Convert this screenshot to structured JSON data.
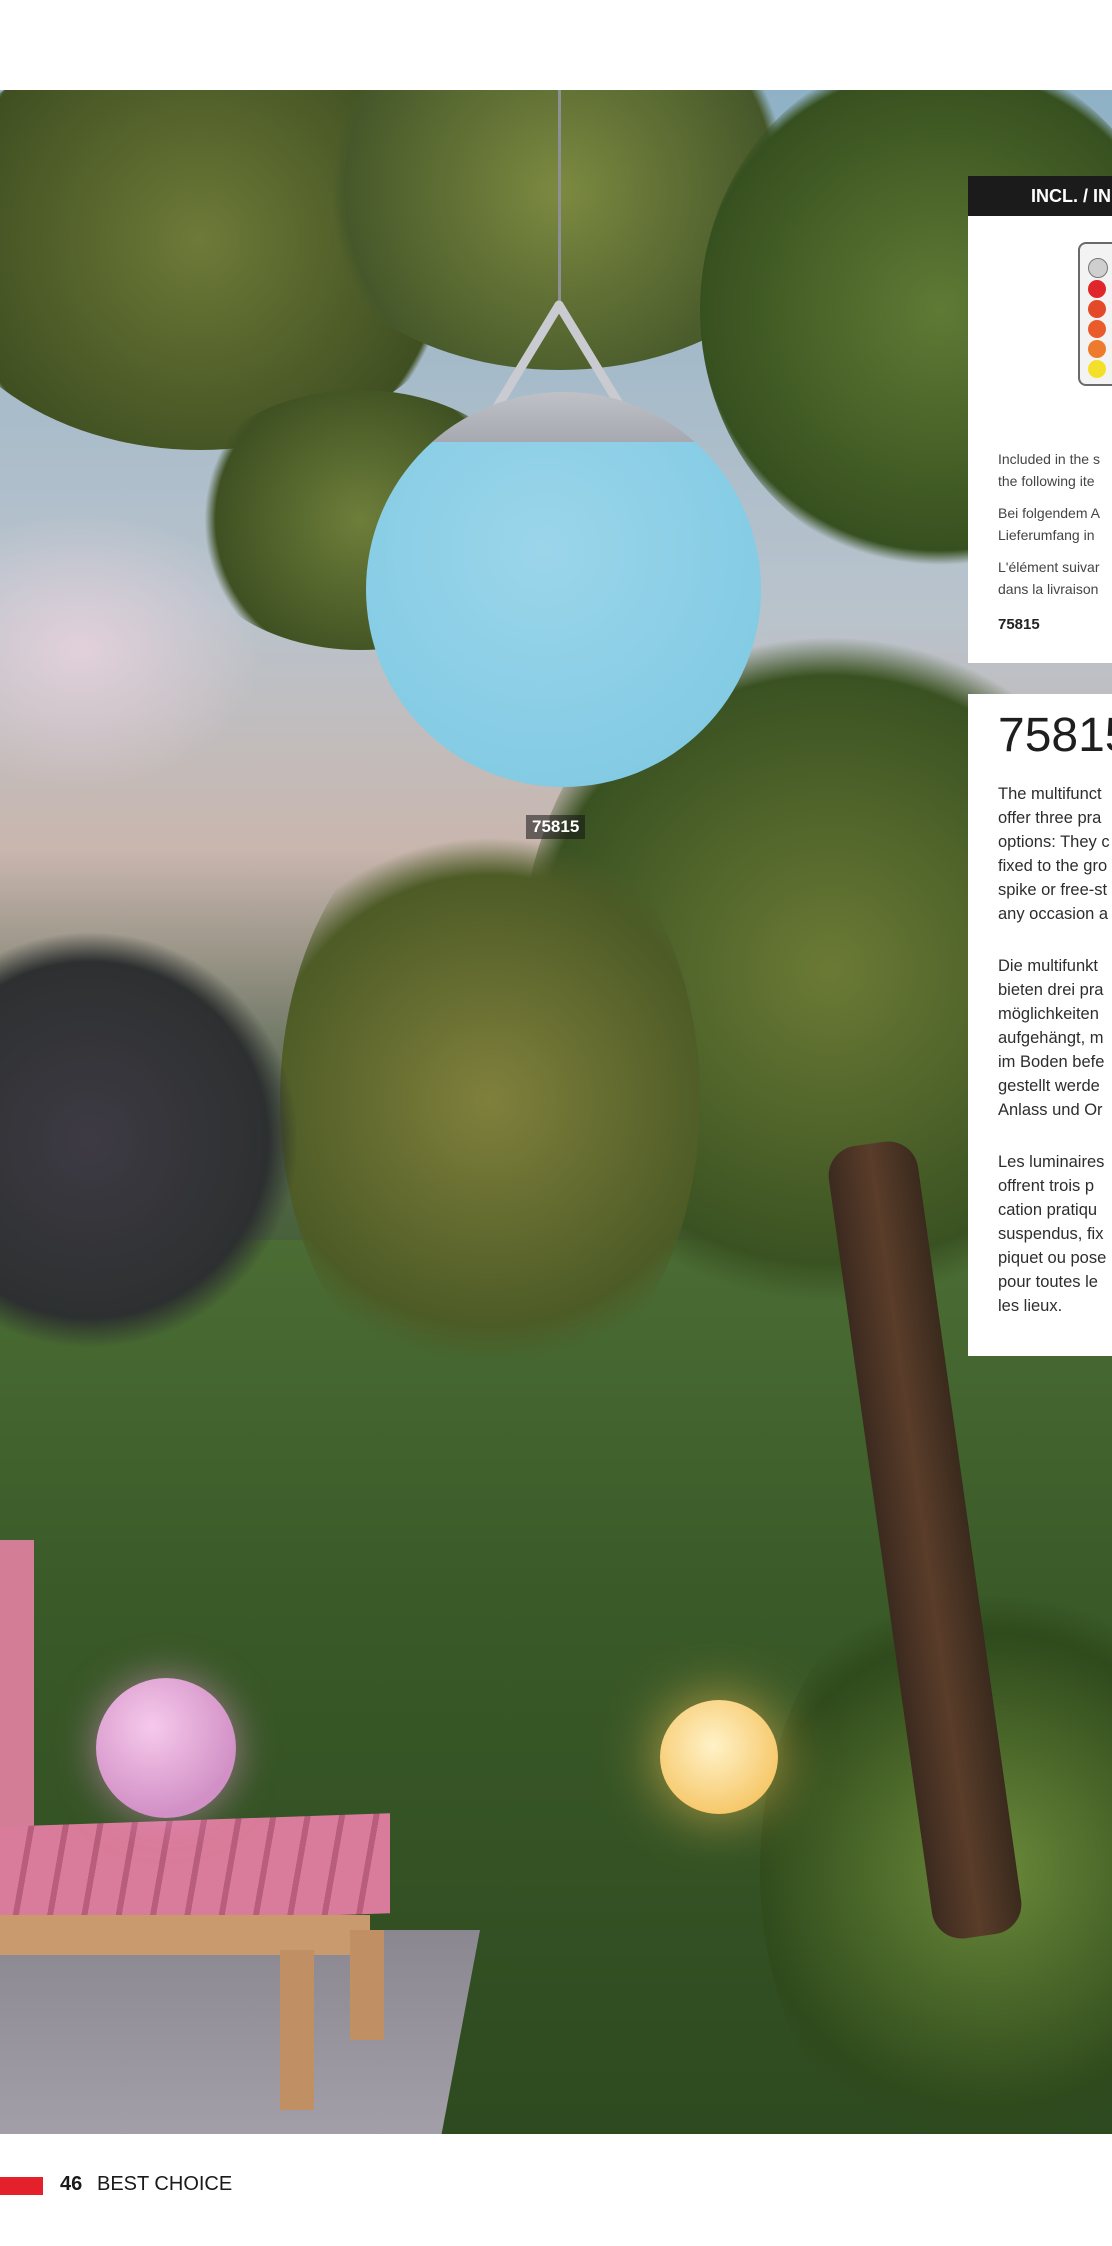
{
  "hero": {
    "product_tag": "75815"
  },
  "included_panel": {
    "header": "INCL. / IN",
    "lines": [
      "Included in the s",
      "the following ite",
      "Bei folgendem A",
      "Lieferumfang in",
      "L'élément suivar",
      "dans la livraison"
    ],
    "item_number": "75815"
  },
  "description_panel": {
    "title": "75815",
    "en": [
      "The multifunct",
      "offer three pra",
      "options: They c",
      "fixed to the gro",
      "spike or free-st",
      "any occasion a"
    ],
    "de": [
      "Die multifunkt",
      "bieten drei pra",
      "möglichkeiten",
      "aufgehängt, m",
      "im Boden befe",
      "gestellt werde",
      "Anlass und Or"
    ],
    "fr": [
      "Les luminaires",
      "offrent trois p",
      "cation pratiqu",
      "suspendus, fix",
      "piquet ou pose",
      "pour toutes le",
      "les lieux."
    ]
  },
  "footer": {
    "page_number": "46",
    "label": "BEST CHOICE"
  },
  "colors": {
    "accent_red": "#e4202a",
    "lamp_blue": "#87cde5",
    "panel_header": "#1b1b1b"
  }
}
